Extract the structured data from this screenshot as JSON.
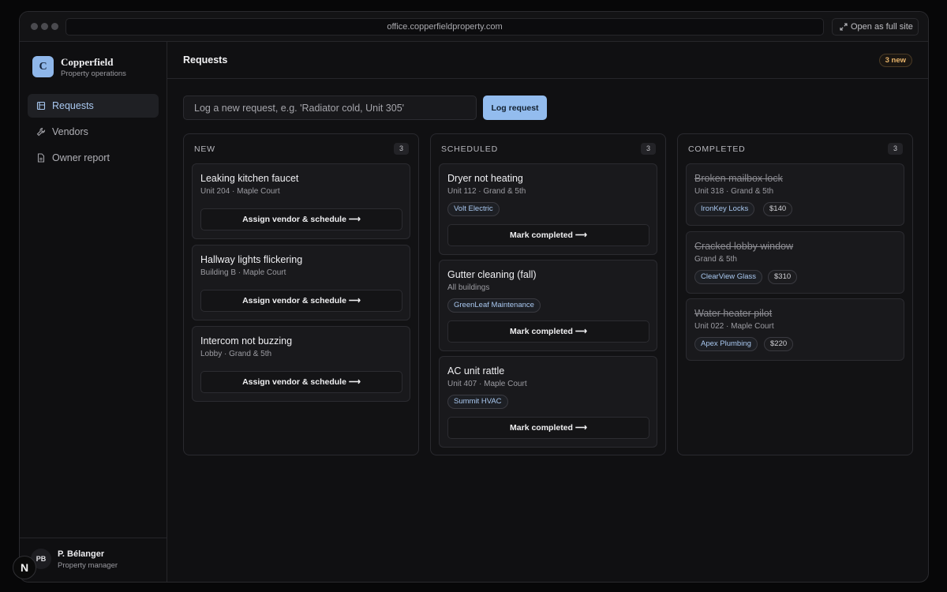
{
  "browser": {
    "url": "office.copperfieldproperty.com",
    "open_full_site": "Open as full site"
  },
  "sidebar": {
    "brand_letter": "C",
    "brand_name": "Copperfield",
    "brand_sub": "Property operations",
    "items": [
      {
        "label": "Requests",
        "icon": "requests-icon",
        "active": true
      },
      {
        "label": "Vendors",
        "icon": "wrench-icon",
        "active": false
      },
      {
        "label": "Owner report",
        "icon": "document-icon",
        "active": false
      }
    ],
    "user": {
      "initials": "PB",
      "name": "P. Bélanger",
      "role": "Property manager"
    }
  },
  "header": {
    "title": "Requests",
    "new_badge": "3 new"
  },
  "composer": {
    "placeholder": "Log a new request, e.g. 'Radiator cold, Unit 305'",
    "button": "Log request"
  },
  "columns": [
    {
      "title": "NEW",
      "count": "3",
      "cards": [
        {
          "title": "Leaking kitchen faucet",
          "sub": "Unit 204 · Maple Court",
          "action": "Assign vendor & schedule ⟶"
        },
        {
          "title": "Hallway lights flickering",
          "sub": "Building B · Maple Court",
          "action": "Assign vendor & schedule ⟶"
        },
        {
          "title": "Intercom not buzzing",
          "sub": "Lobby · Grand & 5th",
          "action": "Assign vendor & schedule ⟶"
        }
      ]
    },
    {
      "title": "SCHEDULED",
      "count": "3",
      "cards": [
        {
          "title": "Dryer not heating",
          "sub": "Unit 112 · Grand & 5th",
          "vendor": "Volt Electric",
          "action": "Mark completed ⟶"
        },
        {
          "title": "Gutter cleaning (fall)",
          "sub": "All buildings",
          "vendor": "GreenLeaf Maintenance",
          "action": "Mark completed ⟶"
        },
        {
          "title": "AC unit rattle",
          "sub": "Unit 407 · Maple Court",
          "vendor": "Summit HVAC",
          "action": "Mark completed ⟶"
        }
      ]
    },
    {
      "title": "COMPLETED",
      "count": "3",
      "cards": [
        {
          "title": "Broken mailbox lock",
          "sub": "Unit 318 · Grand & 5th",
          "vendor": "IronKey Locks",
          "price": "$140"
        },
        {
          "title": "Cracked lobby window",
          "sub": "Grand & 5th",
          "vendor": "ClearView Glass",
          "price": "$310"
        },
        {
          "title": "Water heater pilot",
          "sub": "Unit 022 · Maple Court",
          "vendor": "Apex Plumbing",
          "price": "$220"
        }
      ]
    }
  ],
  "overlay": {
    "badge": "N"
  },
  "colors": {
    "accent": "#93bcee",
    "new_badge": "#e8b46a",
    "background": "#101012"
  }
}
